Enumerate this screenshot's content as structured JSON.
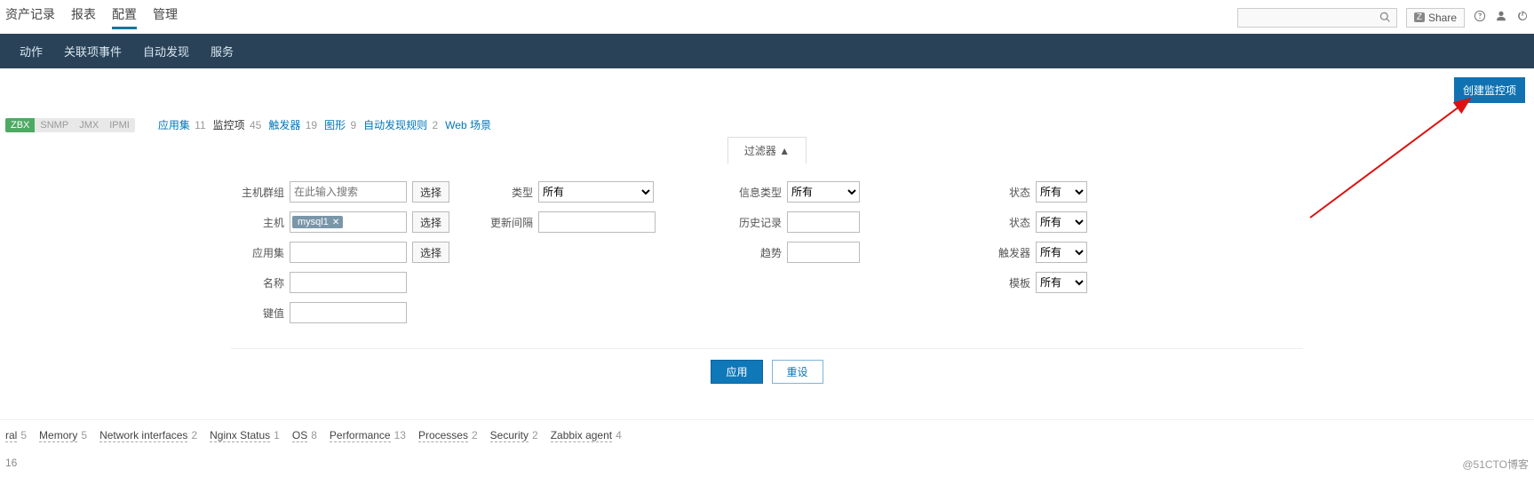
{
  "topnav": {
    "items": [
      "资产记录",
      "报表",
      "配置",
      "管理"
    ],
    "active_index": 2,
    "share": "Share"
  },
  "subnav": {
    "items": [
      "动作",
      "关联项事件",
      "自动发现",
      "服务"
    ]
  },
  "toolbar": {
    "create_button": "创建监控项"
  },
  "hosttypes": {
    "zbx": "ZBX",
    "snmp": "SNMP",
    "jmx": "JMX",
    "ipmi": "IPMI",
    "tabs": [
      {
        "label": "应用集",
        "count": "11"
      },
      {
        "label": "监控项",
        "count": "45"
      },
      {
        "label": "触发器",
        "count": "19"
      },
      {
        "label": "图形",
        "count": "9"
      },
      {
        "label": "自动发现规则",
        "count": "2"
      },
      {
        "label": "Web 场景",
        "count": ""
      }
    ]
  },
  "filter": {
    "toggle": "过滤器 ▲",
    "labels": {
      "hostgroup": "主机群组",
      "host": "主机",
      "appset": "应用集",
      "name": "名称",
      "key": "键值",
      "type": "类型",
      "interval": "更新间隔",
      "infotype": "信息类型",
      "history": "历史记录",
      "trend": "趋势",
      "status": "状态",
      "state": "状态",
      "trigger": "触发器",
      "template": "模板"
    },
    "placeholder_search": "在此输入搜索",
    "select_btn": "选择",
    "host_tag": "mysql1",
    "options": {
      "all": "所有"
    },
    "apply": "应用",
    "reset": "重设"
  },
  "categories": [
    {
      "label": "ral",
      "count": "5"
    },
    {
      "label": "Memory",
      "count": "5"
    },
    {
      "label": "Network interfaces",
      "count": "2"
    },
    {
      "label": "Nginx Status",
      "count": "1"
    },
    {
      "label": "OS",
      "count": "8"
    },
    {
      "label": "Performance",
      "count": "13"
    },
    {
      "label": "Processes",
      "count": "2"
    },
    {
      "label": "Security",
      "count": "2"
    },
    {
      "label": "Zabbix agent",
      "count": "4"
    }
  ],
  "bottom_count": "16",
  "watermark": "@51CTO博客"
}
